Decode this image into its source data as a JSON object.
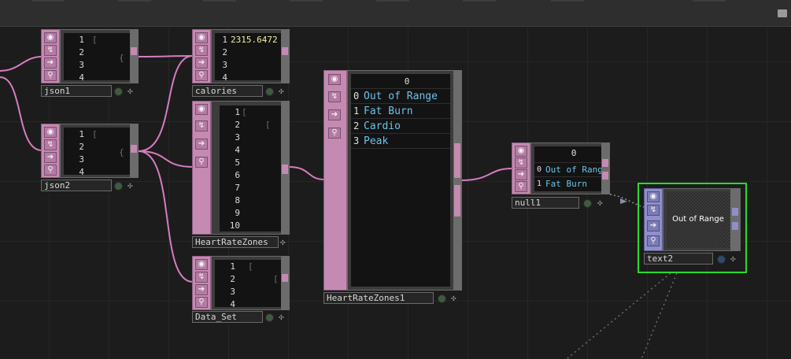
{
  "nodes": {
    "json1": {
      "name": "json1",
      "lines": [
        "1",
        "2",
        "3",
        "4"
      ]
    },
    "json2": {
      "name": "json2",
      "lines": [
        "1",
        "2",
        "3",
        "4"
      ]
    },
    "calories": {
      "name": "calories",
      "lines": [
        "1",
        "2",
        "3",
        "4"
      ],
      "value": "2315.6472"
    },
    "heartratezones": {
      "name": "HeartRateZones",
      "lines": [
        "1",
        "2",
        "3",
        "4",
        "5",
        "6",
        "7",
        "8",
        "9",
        "10"
      ]
    },
    "dataset": {
      "name": "Data_Set",
      "lines": [
        "1",
        "2",
        "3",
        "4"
      ]
    },
    "heartratezones1": {
      "name": "HeartRateZones1",
      "header": "0",
      "rows": [
        {
          "index": "0",
          "value": "Out of Range"
        },
        {
          "index": "1",
          "value": "Fat Burn"
        },
        {
          "index": "2",
          "value": "Cardio"
        },
        {
          "index": "3",
          "value": "Peak"
        }
      ]
    },
    "null1": {
      "name": "null1",
      "header": "0",
      "rows": [
        {
          "index": "0",
          "value": "Out of Range"
        },
        {
          "index": "1",
          "value": "Fat Burn"
        }
      ]
    },
    "text2": {
      "name": "text2",
      "preview_text": "Out of Range"
    }
  },
  "colors": {
    "dat_operator": "#c48ab1",
    "top_operator": "#8f8fc9",
    "selected": "#2bd92b",
    "table_text": "#6cc2e8",
    "wire": "#d77cc0"
  }
}
